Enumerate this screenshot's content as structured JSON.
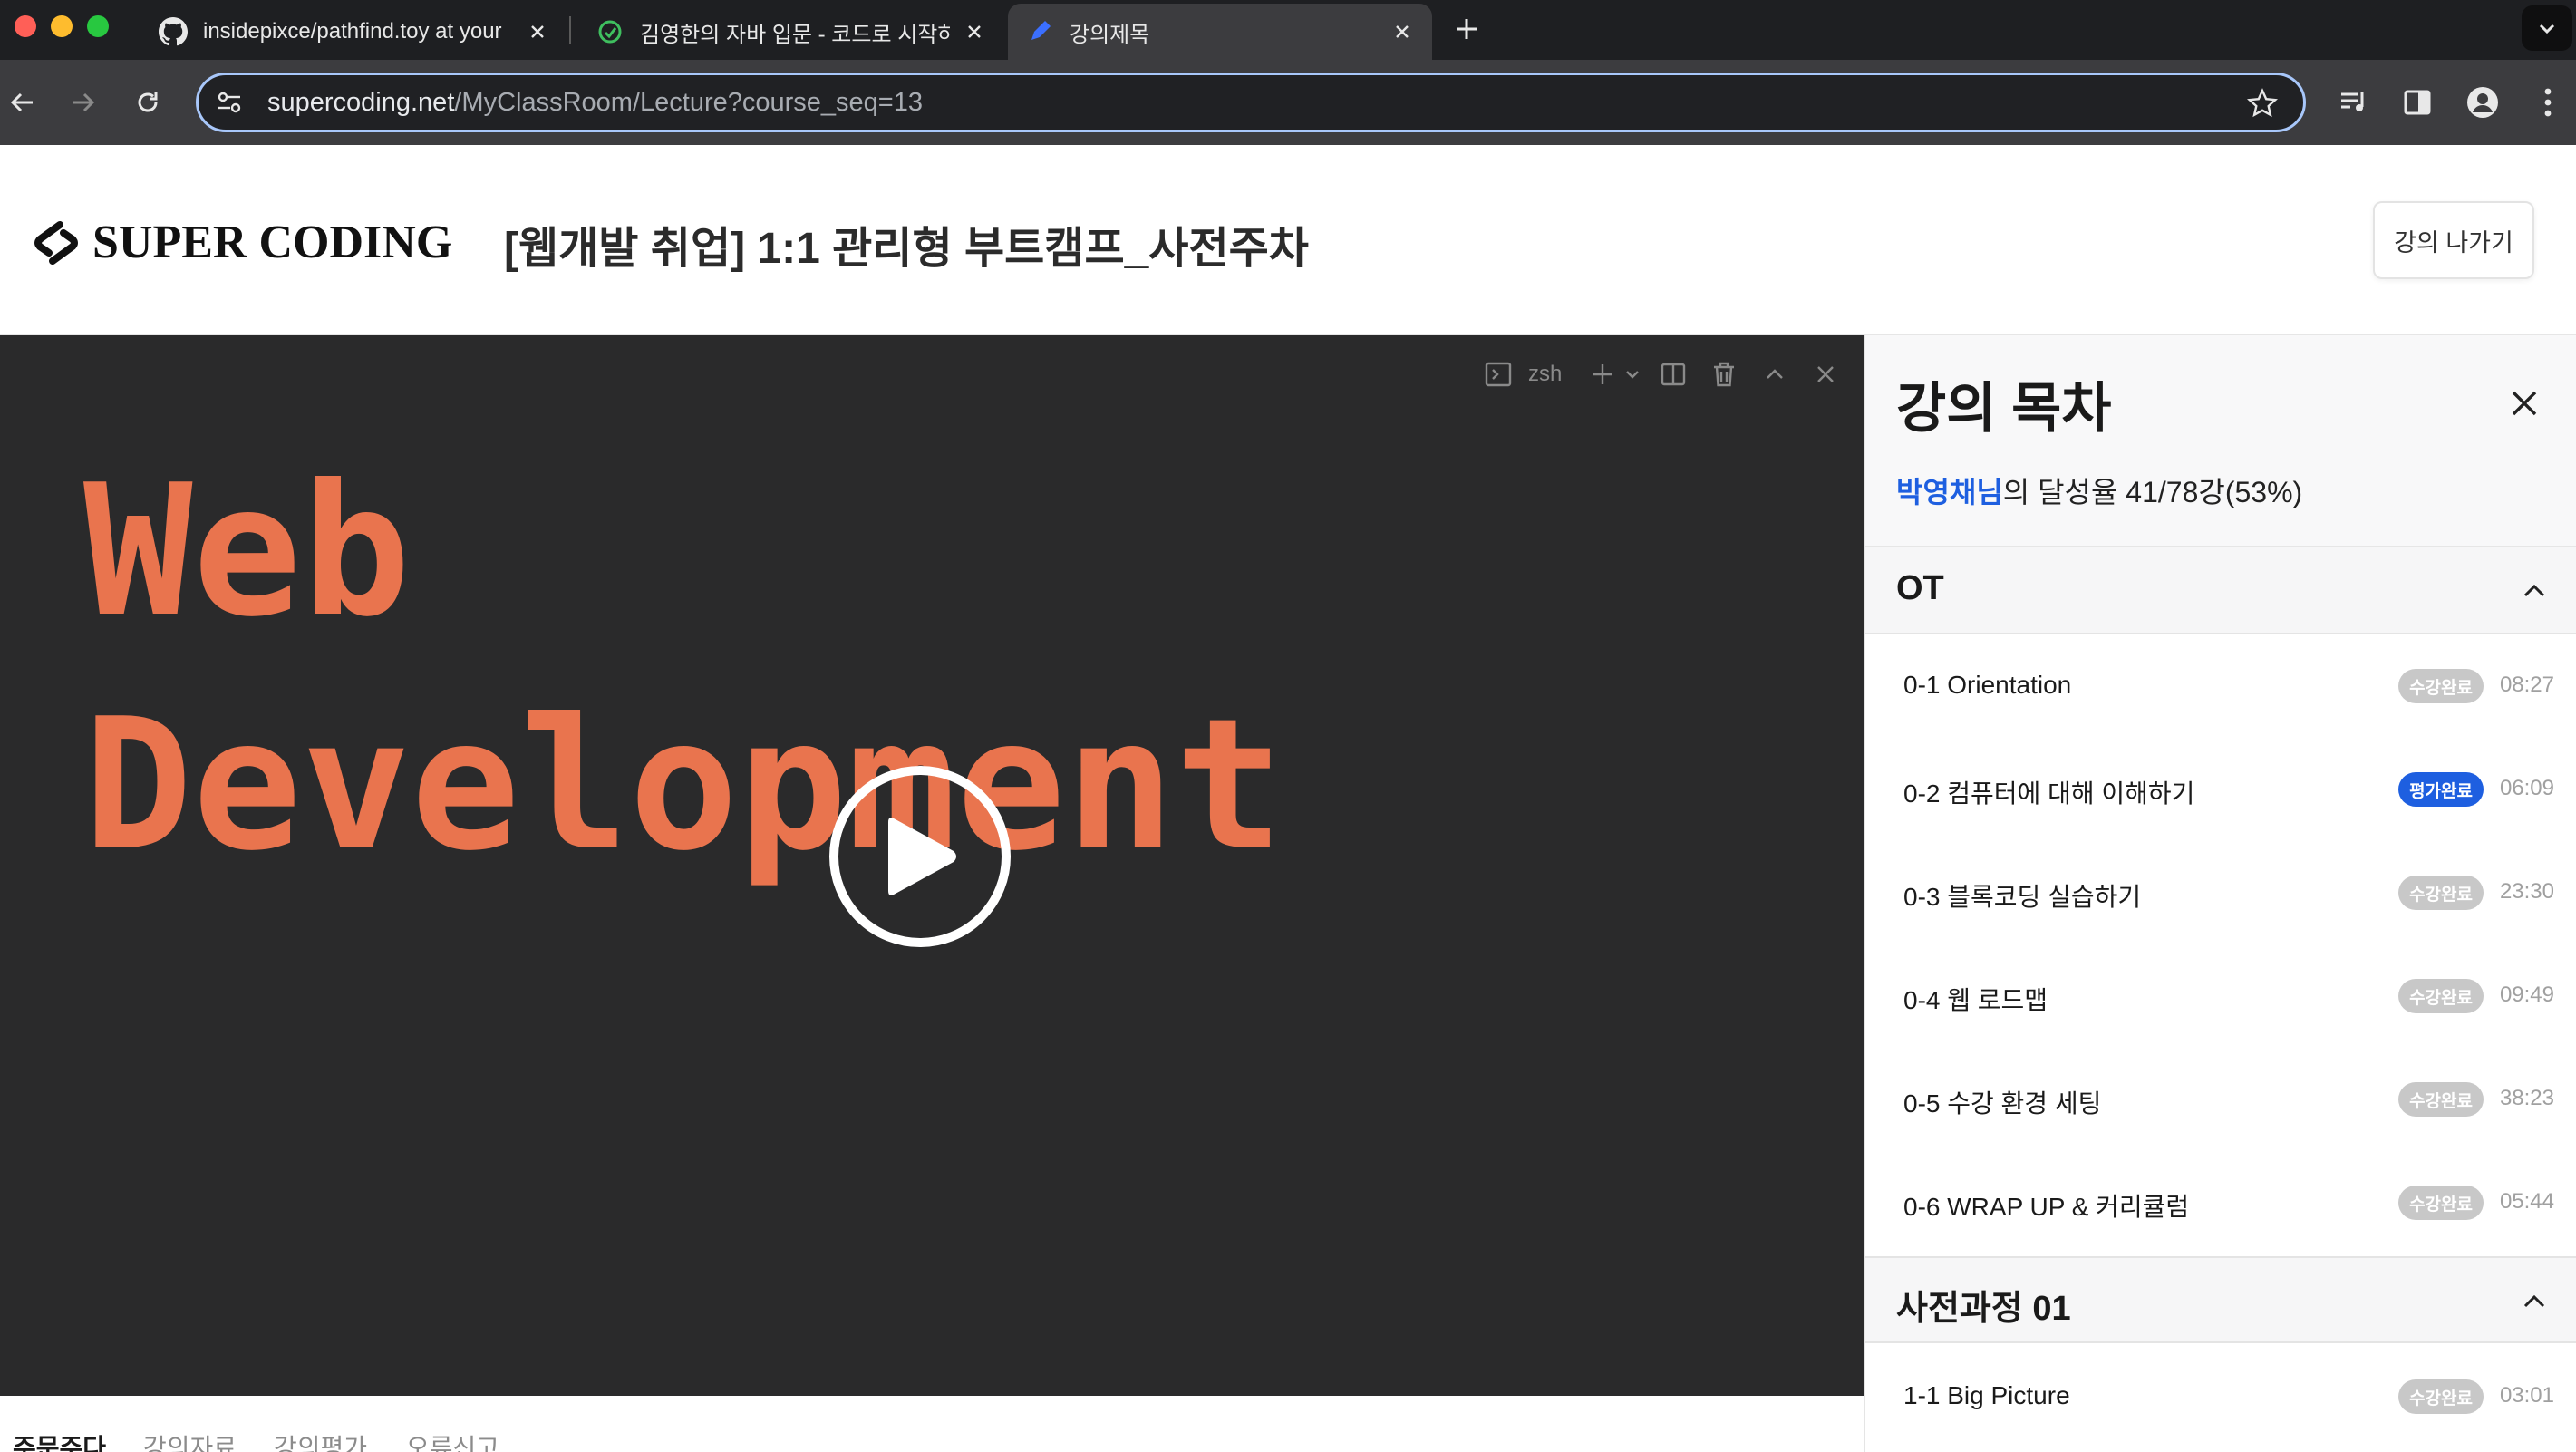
{
  "browser": {
    "tabs": [
      {
        "title": "insidepixce/pathfind.toy at your",
        "icon": "github-icon"
      },
      {
        "title": "김영한의 자바 입문 - 코드로 시작하",
        "icon": "inflearn-icon"
      },
      {
        "title": "강의제목",
        "icon": "pen-icon",
        "active": true
      }
    ],
    "url_host": "supercoding.net",
    "url_path": "/MyClassRoom/Lecture?course_seq=13"
  },
  "header": {
    "brand": "SUPER CODING",
    "course_title": "[웹개발 취업] 1:1 관리형 부트캠프_사전주차",
    "exit_label": "강의 나가기"
  },
  "video": {
    "terminal_label": "zsh",
    "line1": "Web",
    "line2": "Development",
    "code_color": "#e9744e"
  },
  "bottom_tabs": [
    "주문주다",
    "강의자료",
    "강의평가",
    "오류신고"
  ],
  "sidebar": {
    "title": "강의 목차",
    "user_name": "박영채님",
    "progress_text": "의 달성율 41/78강(53%)",
    "sections": [
      {
        "title": "OT",
        "lessons": [
          {
            "name": "0-1 Orientation",
            "badge": "수강완료",
            "duration": "08:27"
          },
          {
            "name": "0-2 컴퓨터에 대해 이해하기",
            "badge": "평가완료",
            "duration": "06:09"
          },
          {
            "name": "0-3 블록코딩 실습하기",
            "badge": "수강완료",
            "duration": "23:30"
          },
          {
            "name": "0-4 웹 로드맵",
            "badge": "수강완료",
            "duration": "09:49"
          },
          {
            "name": "0-5 수강 환경 세팅",
            "badge": "수강완료",
            "duration": "38:23"
          },
          {
            "name": "0-6 WRAP UP & 커리큘럼",
            "badge": "수강완료",
            "duration": "05:44"
          }
        ]
      },
      {
        "title": "사전과정 01",
        "lessons": [
          {
            "name": "1-1 Big Picture",
            "badge": "수강완료",
            "duration": "03:01"
          }
        ]
      }
    ],
    "colors": {
      "accent": "#1e5fe0",
      "badge_done": "#c8c8c8"
    }
  }
}
